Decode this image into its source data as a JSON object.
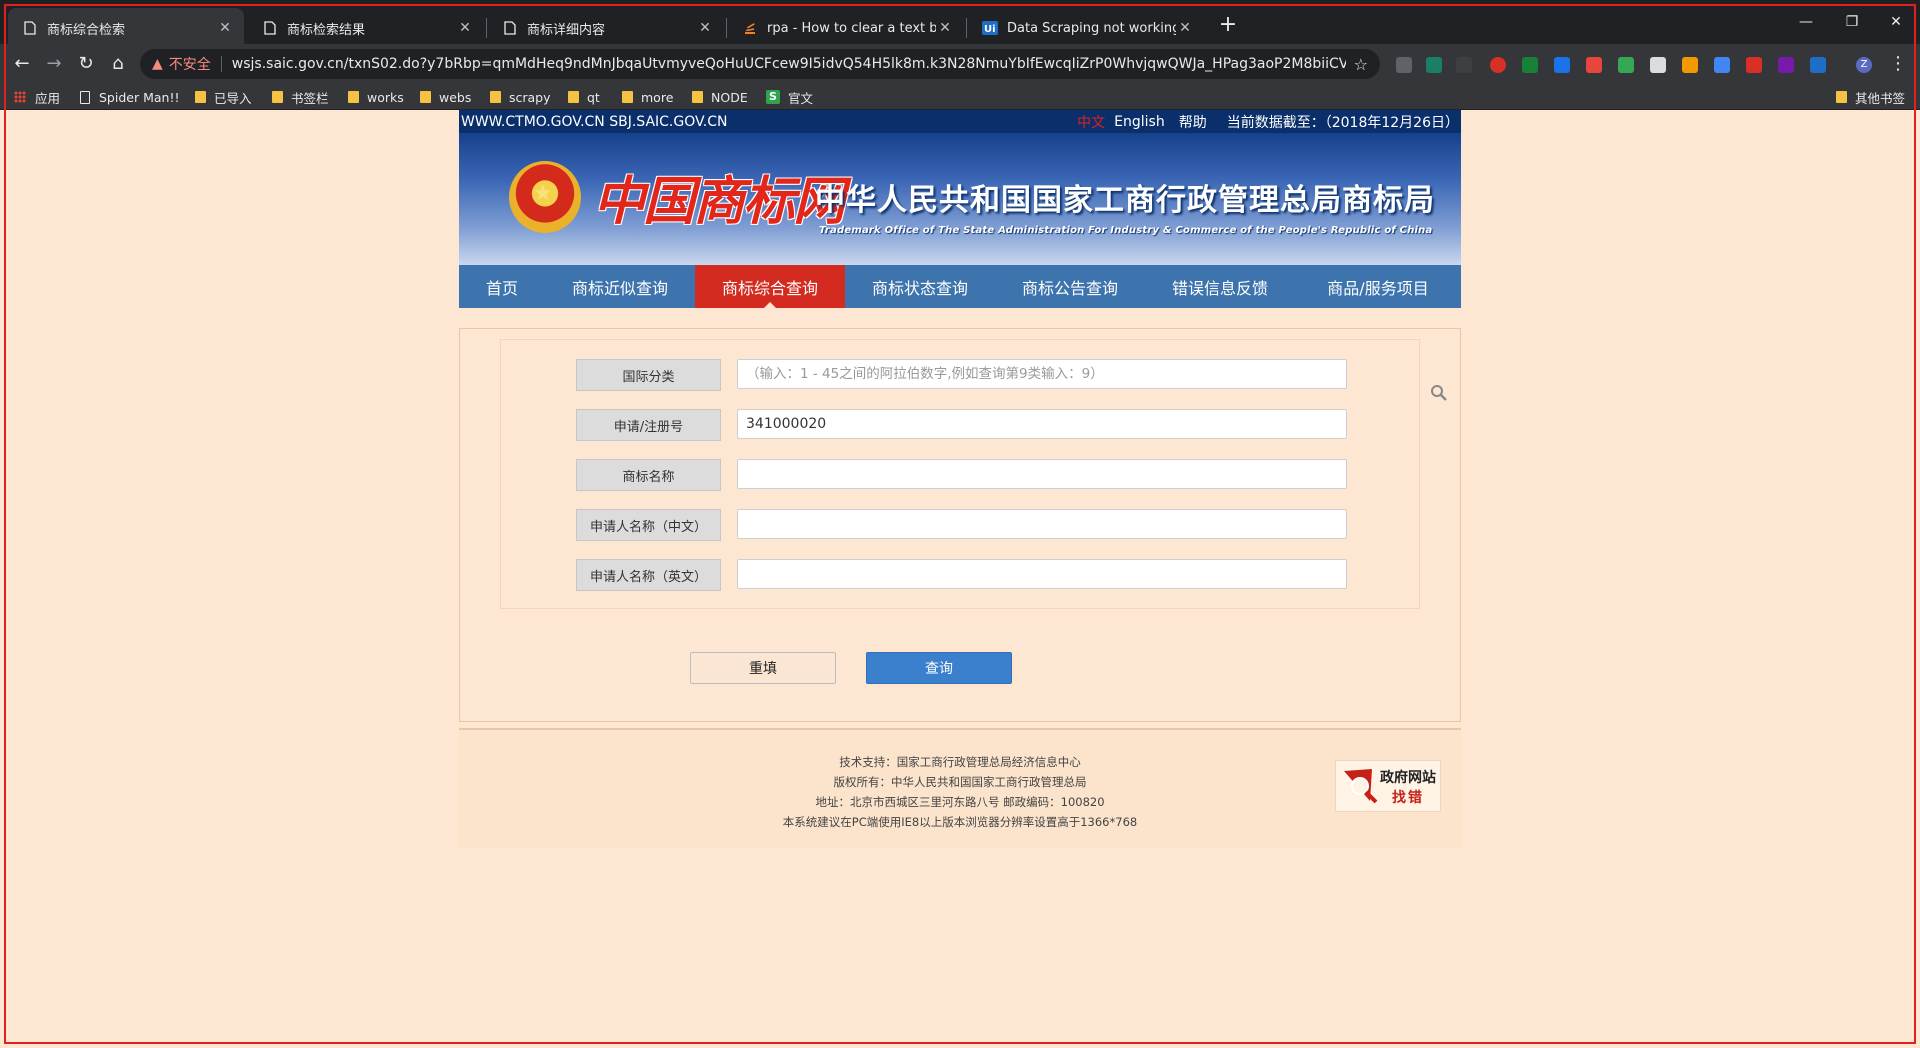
{
  "browser": {
    "tabs": [
      {
        "label": "商标综合检索",
        "active": true
      },
      {
        "label": "商标检索结果",
        "active": false
      },
      {
        "label": "商标详细内容",
        "active": false
      },
      {
        "label": "rpa - How to clear a text box in",
        "active": false
      },
      {
        "label": "Data Scraping not working in t",
        "active": false
      }
    ],
    "new_tab_symbol": "+",
    "window_controls": {
      "minimize": "—",
      "restore": "❐",
      "close": "✕"
    },
    "security_label": "不安全",
    "url": "wsjs.saic.gov.cn/txnS02.do?y7bRbp=qmMdHeq9ndMnJbqaUtvmyveQoHuUCFcew9I5idvQ54H5lk8m.k3N28NmuYbIfEwcqIiZrP0WhvjqwQWJa_HPag3aoP2M8biiCVc...",
    "bookmarks": [
      {
        "label": "应用",
        "kind": "apps"
      },
      {
        "label": "Spider Man!!",
        "kind": "page"
      },
      {
        "label": "已导入",
        "kind": "folder"
      },
      {
        "label": "书签栏",
        "kind": "folder"
      },
      {
        "label": "works",
        "kind": "folder"
      },
      {
        "label": "webs",
        "kind": "folder"
      },
      {
        "label": "scrapy",
        "kind": "folder"
      },
      {
        "label": "qt",
        "kind": "folder"
      },
      {
        "label": "more",
        "kind": "folder"
      },
      {
        "label": "NODE",
        "kind": "folder"
      },
      {
        "label": "官文",
        "kind": "s-icon"
      }
    ],
    "other_bookmarks": "其他书签",
    "profile_initial": "Z"
  },
  "site": {
    "topbar": {
      "domains": "WWW.CTMO.GOV.CN SBJ.SAIC.GOV.CN",
      "lang_zh": "中文",
      "lang_en": "English",
      "help": "帮助",
      "data_as_of": "当前数据截至：（2018年12月26日）"
    },
    "banner": {
      "logo_text": "中国商标网",
      "org_cn": "中华人民共和国国家工商行政管理总局商标局",
      "org_en": "Trademark Office of The State Administration For Industry & Commerce of the People's Republic of China"
    },
    "nav": [
      {
        "label": "首页",
        "active": false
      },
      {
        "label": "商标近似查询",
        "active": false
      },
      {
        "label": "商标综合查询",
        "active": true
      },
      {
        "label": "商标状态查询",
        "active": false
      },
      {
        "label": "商标公告查询",
        "active": false
      },
      {
        "label": "错误信息反馈",
        "active": false
      },
      {
        "label": "商品/服务项目",
        "active": false
      }
    ],
    "form": {
      "fields": [
        {
          "label": "国际分类",
          "value": "",
          "placeholder": "（输入：1 - 45之间的阿拉伯数字,例如查询第9类输入：9）"
        },
        {
          "label": "申请/注册号",
          "value": "341000020",
          "placeholder": ""
        },
        {
          "label": "商标名称",
          "value": "",
          "placeholder": ""
        },
        {
          "label": "申请人名称（中文）",
          "value": "",
          "placeholder": ""
        },
        {
          "label": "申请人名称（英文）",
          "value": "",
          "placeholder": ""
        }
      ],
      "reset_label": "重填",
      "query_label": "查询"
    },
    "footer": {
      "lines": [
        "技术支持：国家工商行政管理总局经济信息中心",
        "版权所有：中华人民共和国国家工商行政管理总局",
        "地址：北京市西城区三里河东路八号  邮政编码：100820",
        "本系统建议在PC端使用IE8以上版本浏览器分辨率设置高于1366*768"
      ],
      "gov_badge_line1": "政府网站",
      "gov_badge_line2": "找错"
    }
  },
  "colors": {
    "page_bg": "#fde7d2",
    "nav_bg": "#3e74ad",
    "nav_active": "#d32b1f",
    "query_button": "#3b80cc",
    "topbar_bg": "#0a2f6b"
  }
}
